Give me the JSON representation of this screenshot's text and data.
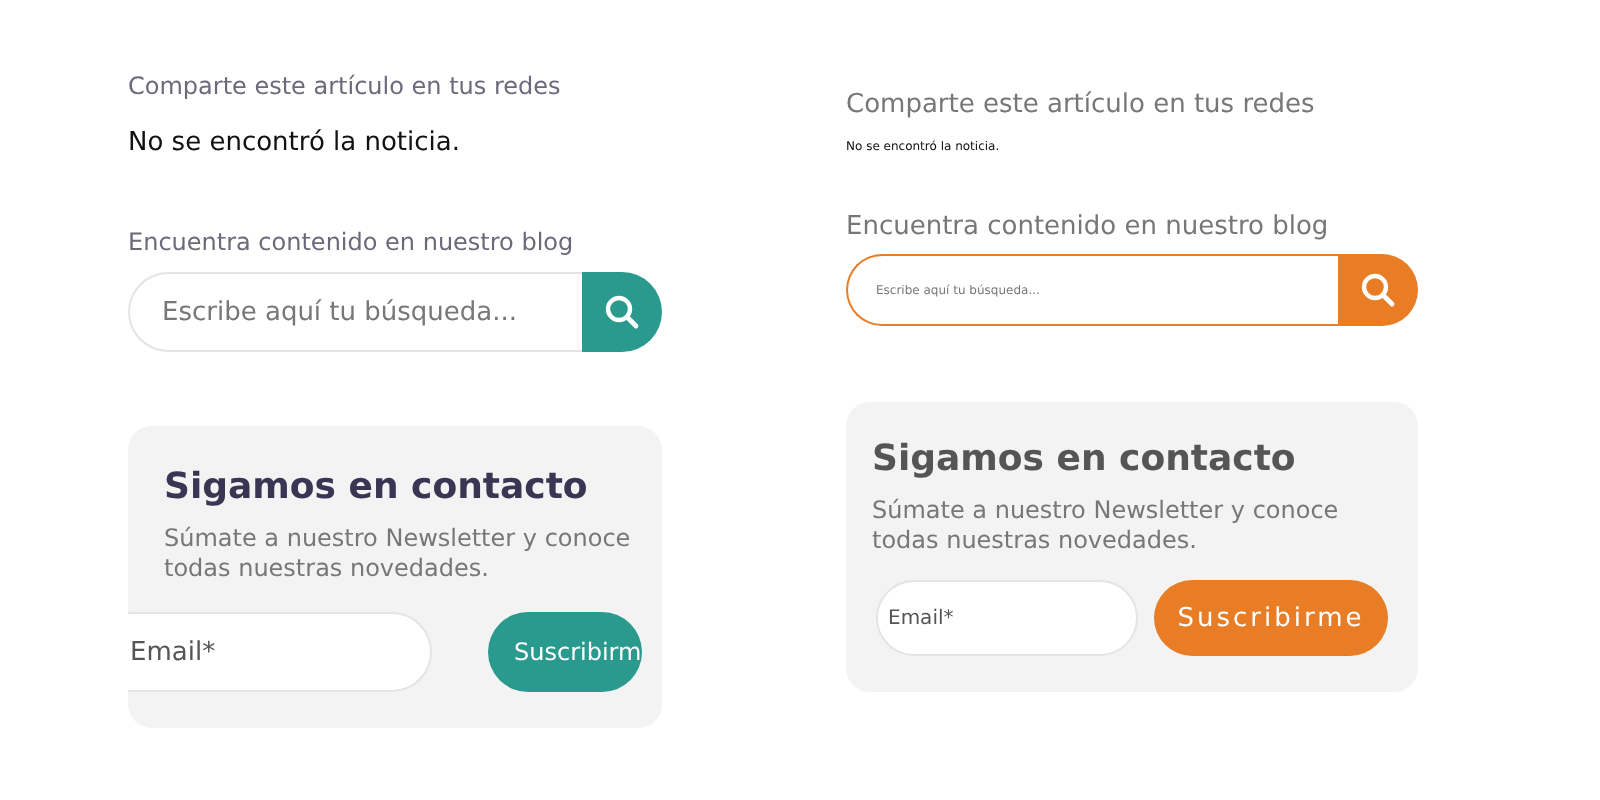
{
  "panels": [
    {
      "kind": "mobile",
      "color": "#2a9a8e",
      "share_label": "Comparte este artículo en tus redes",
      "notice": "No se encontró la noticia.",
      "blog_label": "Encuentra contenido en nuestro blog",
      "search": {
        "placeholder": "Escribe aquí tu búsqueda..."
      },
      "newsletter": {
        "title": "Sigamos en contacto",
        "description": "Súmate a nuestro Newsletter y conoce todas nuestras novedades.",
        "email": {
          "placeholder": "Email*"
        },
        "button": "Suscribirm"
      }
    },
    {
      "kind": "desktop",
      "color": "#e87d25",
      "share_label": "Comparte este artículo en tus redes",
      "notice": "No se encontró la noticia.",
      "blog_label": "Encuentra contenido en nuestro blog",
      "search": {
        "placeholder": "Escribe aquí tu búsqueda..."
      },
      "newsletter": {
        "title": "Sigamos en contacto",
        "description": "Súmate a nuestro Newsletter y conoce todas nuestras novedades.",
        "email": {
          "placeholder": "Email*"
        },
        "button": "Suscribirme"
      }
    }
  ]
}
